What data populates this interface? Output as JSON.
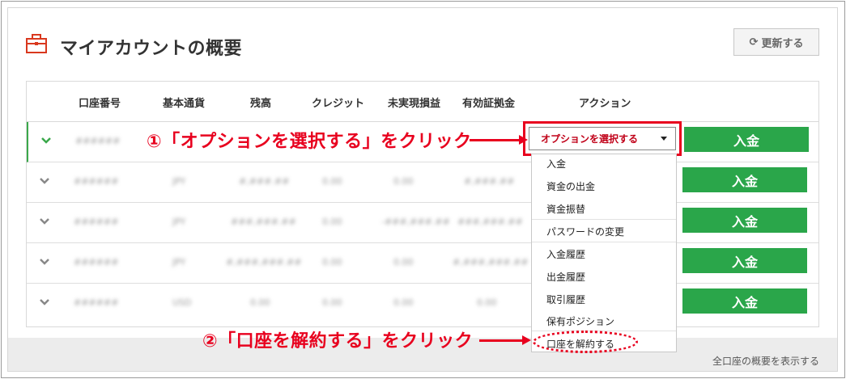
{
  "header": {
    "title": "マイアカウントの概要",
    "refresh_label": "更新する"
  },
  "table": {
    "columns": [
      "口座番号",
      "基本通貨",
      "残高",
      "クレジット",
      "未実現損益",
      "有効証拠金",
      "アクション"
    ],
    "rows": [
      {
        "account": "######",
        "currency": "",
        "balance": "",
        "credit": "",
        "unrealized": "",
        "equity": "",
        "deposit_label": "入金"
      },
      {
        "account": "######",
        "currency": "JPY",
        "balance": "#,###.##",
        "credit": "0.00",
        "unrealized": "0.00",
        "equity": "#,###.##",
        "deposit_label": "入金"
      },
      {
        "account": "######",
        "currency": "JPY",
        "balance": "###,###.##",
        "credit": "0.00",
        "unrealized": "-###,###.##",
        "equity": "###,###.##",
        "deposit_label": "入金"
      },
      {
        "account": "######",
        "currency": "JPY",
        "balance": "#,###,###.##",
        "credit": "0.00",
        "unrealized": "0.00",
        "equity": "#,###,###.##",
        "deposit_label": "入金"
      },
      {
        "account": "######",
        "currency": "USD",
        "balance": "0.00",
        "credit": "0.00",
        "unrealized": "0.00",
        "equity": "0.00",
        "deposit_label": "入金"
      }
    ]
  },
  "select": {
    "value": "オプションを選択する"
  },
  "dropdown": {
    "items": [
      "入金",
      "資金の出金",
      "資金振替",
      "パスワードの変更",
      "入金履歴",
      "出金履歴",
      "取引履歴",
      "保有ポジション",
      "口座を解約する"
    ]
  },
  "footer": {
    "link": "全口座の概要を表示する"
  },
  "annotations": {
    "step1": "①「オプションを選択する」をクリック",
    "step2": "②「口座を解約する」をクリック"
  },
  "colors": {
    "accent_green": "#2aa64a",
    "annotation_red": "#e8001e"
  }
}
